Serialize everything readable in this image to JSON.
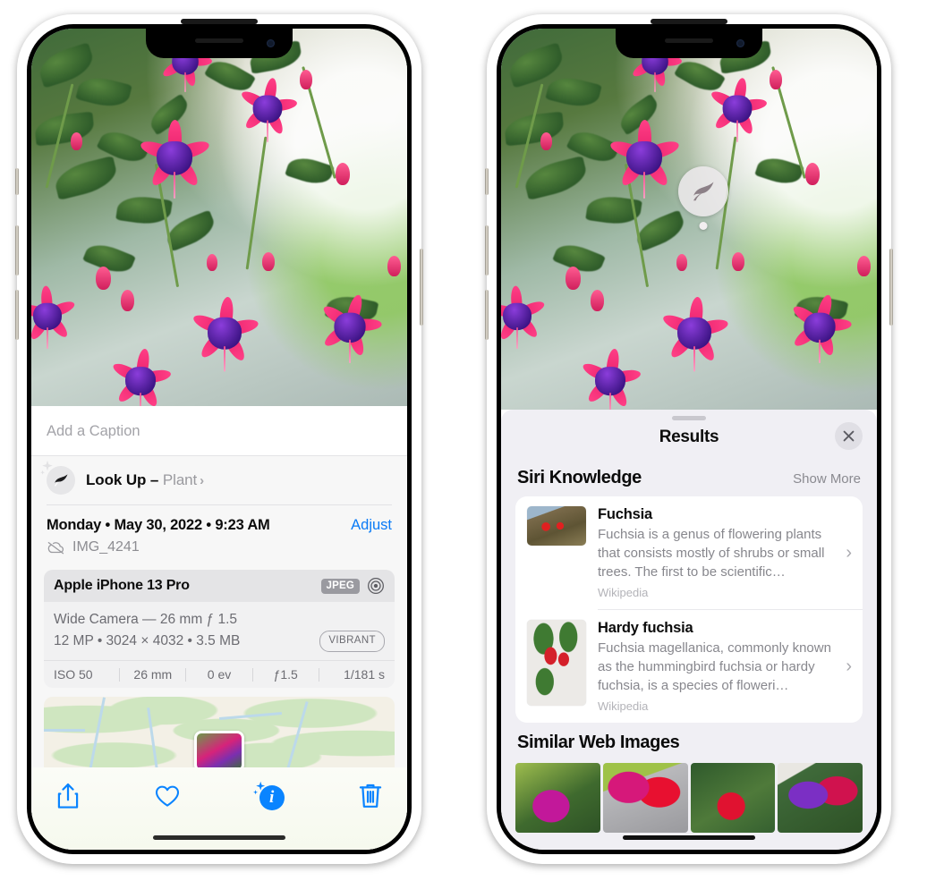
{
  "left_phone": {
    "photo": {
      "alt_name": "fuchsia-flowers-photo"
    },
    "caption_field": {
      "placeholder": "Add a Caption",
      "value": ""
    },
    "lookup": {
      "label_bold": "Look Up – ",
      "label_dim": "Plant",
      "chevron": "›",
      "icon": "leaf-icon"
    },
    "date_row": {
      "date": "Monday • May 30, 2022 • 9:23 AM",
      "adjust_label": "Adjust",
      "filename": "IMG_4241",
      "cloud_icon": "cloud-slash-icon"
    },
    "camera_card": {
      "model": "Apple iPhone 13 Pro",
      "format_tag": "JPEG",
      "raw_icon": "aperture-icon",
      "lens_line": "Wide Camera — 26 mm ƒ 1.5",
      "specs_line": "12 MP  •  3024 × 4032  •  3.5 MB",
      "style_tag": "VIBRANT",
      "exif": [
        "ISO 50",
        "26 mm",
        "0 ev",
        "ƒ1.5",
        "1/181 s"
      ]
    },
    "map": {
      "name": "location-map-preview"
    },
    "toolbar": {
      "share_label": "share-icon",
      "favorite_label": "heart-icon",
      "info_label": "info-icon",
      "info_glyph": "i",
      "delete_label": "trash-icon"
    }
  },
  "right_phone": {
    "photo_badge": {
      "icon": "leaf-icon"
    },
    "sheet": {
      "title": "Results",
      "close_label": "close-icon"
    },
    "siri_knowledge": {
      "heading": "Siri Knowledge",
      "show_more": "Show More",
      "items": [
        {
          "title": "Fuchsia",
          "description": "Fuchsia is a genus of flowering plants that consists mostly of shrubs or small trees. The first to be scientific…",
          "source": "Wikipedia",
          "chevron": "›"
        },
        {
          "title": "Hardy fuchsia",
          "description": "Fuchsia magellanica, commonly known as the hummingbird fuchsia or hardy fuchsia, is a species of floweri…",
          "source": "Wikipedia",
          "chevron": "›"
        }
      ]
    },
    "similar_web_images": {
      "heading": "Similar Web Images",
      "thumbs": [
        "web-image-1",
        "web-image-2",
        "web-image-3",
        "web-image-4"
      ]
    }
  },
  "colors": {
    "accent_blue": "#0a84ff",
    "sheet_bg": "#f0eff4",
    "info_bg": "#f7f7f7",
    "card_bg": "#ffffff"
  }
}
